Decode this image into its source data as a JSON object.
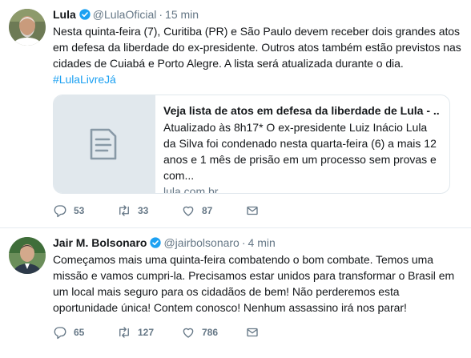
{
  "tweets": [
    {
      "name": "Lula",
      "handle": "@LulaOficial",
      "time": "15 min",
      "text": "Nesta quinta-feira (7), Curitiba (PR) e São Paulo devem receber dois grandes atos em defesa da liberdade do ex-presidente. Outros atos também estão previstos nas cidades de Cuiabá e Porto Alegre. A lista será atualizada durante o dia.",
      "hashtag": "#LulaLivreJá",
      "card": {
        "title": "Veja lista de atos em defesa da liberdade de Lula - ...",
        "description": "Atualizado às 8h17* O ex-presidente Luiz Inácio Lula da Silva foi condenado nesta quarta-feira (6) a mais 12 anos e 1 mês de prisão em um processo sem provas e com...",
        "domain": "lula.com.br",
        "thumb_icon": "document-icon"
      },
      "replies": "53",
      "retweets": "33",
      "likes": "87"
    },
    {
      "name": "Jair M. Bolsonaro",
      "handle": "@jairbolsonaro",
      "time": "4 min",
      "text": "Começamos mais uma quinta-feira combatendo o bom combate. Temos uma missão e vamos cumpri-la. Precisamos estar unidos para transformar o Brasil em um local mais seguro para os cidadãos de bem! Não perderemos esta oportunidade única! Contem conosco! Nenhum assassino irá nos parar!",
      "replies": "65",
      "retweets": "127",
      "likes": "786"
    }
  ],
  "colors": {
    "accent": "#1da1f2",
    "muted": "#657786",
    "text": "#14171a",
    "border": "#e6ecf0"
  },
  "icons": [
    "reply-icon",
    "retweet-icon",
    "like-icon",
    "direct-message-icon",
    "verified-badge-icon"
  ]
}
